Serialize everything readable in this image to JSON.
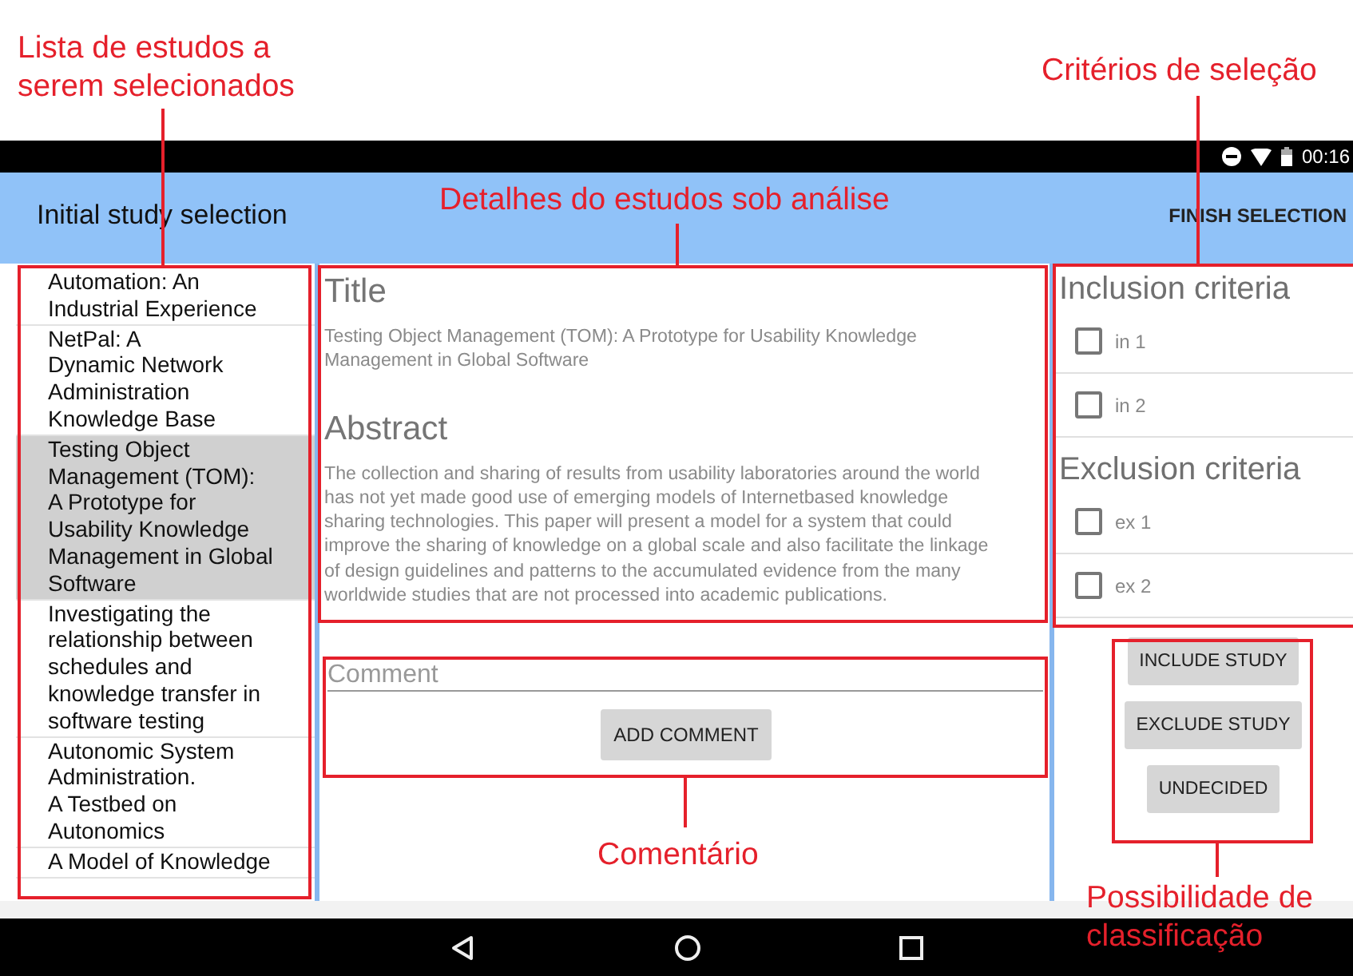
{
  "annotations": [
    {
      "text": "Lista de estudos a\nserem selecionados"
    },
    {
      "text": "Critérios de seleção"
    },
    {
      "text": "Detalhes do estudos sob análise"
    },
    {
      "text": "Comentário"
    },
    {
      "text": "Possibilidade de\nclassificação"
    }
  ],
  "status_bar": {
    "time": "00:16"
  },
  "app_bar": {
    "title": "Initial study selection",
    "action": "FINISH SELECTION"
  },
  "study_list": [
    {
      "title": "Automation: An\nIndustrial Experience",
      "selected": false
    },
    {
      "title": "NetPal: A\nDynamic Network\nAdministration\nKnowledge Base",
      "selected": false
    },
    {
      "title": "Testing Object\nManagement (TOM):\nA Prototype for\nUsability Knowledge\nManagement in Global\nSoftware",
      "selected": true
    },
    {
      "title": "Investigating the\nrelationship between\nschedules and\nknowledge transfer in\nsoftware testing",
      "selected": false
    },
    {
      "title": "Autonomic System\nAdministration.\nA Testbed on\nAutonomics",
      "selected": false
    },
    {
      "title": "A Model of Knowledge",
      "selected": false
    }
  ],
  "details": {
    "title_heading": "Title",
    "title": "Testing Object Management (TOM): A Prototype for Usability Knowledge\nManagement in Global Software",
    "abstract_heading": "Abstract",
    "abstract": "The collection and sharing of results from usability laboratories around the world\nhas not yet made good use of emerging models of Internetbased knowledge\nsharing technologies. This paper will present a model for a system that could\nimprove the sharing of knowledge on a global scale and also facilitate the linkage\nof design guidelines and patterns to the accumulated evidence from the many\nworldwide studies that are not processed into academic publications."
  },
  "comment": {
    "placeholder": "Comment",
    "button": "ADD COMMENT"
  },
  "criteria": [
    {
      "heading": "Inclusion criteria",
      "items": [
        {
          "label": "in 1",
          "checked": false
        },
        {
          "label": "in 2",
          "checked": false
        }
      ]
    },
    {
      "heading": "Exclusion criteria",
      "items": [
        {
          "label": "ex 1",
          "checked": false
        },
        {
          "label": "ex 2",
          "checked": false
        }
      ]
    }
  ],
  "classification_buttons": [
    "INCLUDE STUDY",
    "EXCLUDE STUDY",
    "UNDECIDED"
  ]
}
